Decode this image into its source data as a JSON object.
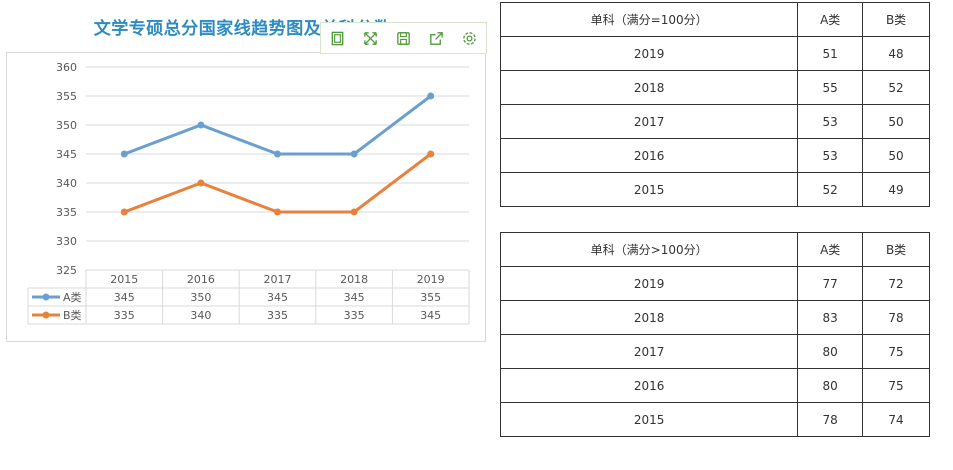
{
  "colors": {
    "series_a": "#6aa0cf",
    "series_b": "#e8813b",
    "title": "#2e8bc0"
  },
  "toolbar": {
    "icons": [
      "data-view-icon",
      "expand-icon",
      "save-icon",
      "share-icon",
      "settings-icon"
    ]
  },
  "chart_data": {
    "type": "line",
    "title": "文学专硕总分国家线趋势图及单科分数",
    "categories": [
      "2015",
      "2016",
      "2017",
      "2018",
      "2019"
    ],
    "series": [
      {
        "name": "A类",
        "values": [
          345,
          350,
          345,
          345,
          355
        ],
        "color": "#6aa0cf"
      },
      {
        "name": "B类",
        "values": [
          335,
          340,
          335,
          335,
          345
        ],
        "color": "#e8813b"
      }
    ],
    "y_ticks": [
      "360",
      "355",
      "350",
      "345",
      "340",
      "335",
      "330",
      "325"
    ],
    "ylim": [
      325,
      360
    ],
    "grid": true,
    "legend": "data-table-below"
  },
  "table1": {
    "header": [
      "单科（满分=100分）",
      "A类",
      "B类"
    ],
    "rows": [
      [
        "2019",
        "51",
        "48"
      ],
      [
        "2018",
        "55",
        "52"
      ],
      [
        "2017",
        "53",
        "50"
      ],
      [
        "2016",
        "53",
        "50"
      ],
      [
        "2015",
        "52",
        "49"
      ]
    ]
  },
  "table2": {
    "header": [
      "单科（满分>100分）",
      "A类",
      "B类"
    ],
    "rows": [
      [
        "2019",
        "77",
        "72"
      ],
      [
        "2018",
        "83",
        "78"
      ],
      [
        "2017",
        "80",
        "75"
      ],
      [
        "2016",
        "80",
        "75"
      ],
      [
        "2015",
        "78",
        "74"
      ]
    ]
  }
}
